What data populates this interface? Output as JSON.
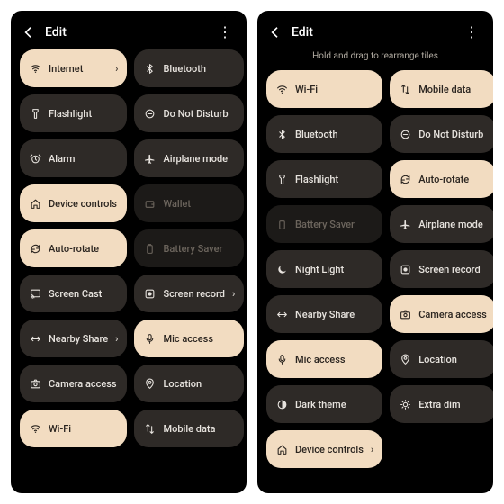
{
  "left": {
    "title": "Edit",
    "tiles": [
      {
        "icon": "wifi",
        "label": "Internet",
        "style": "light",
        "chevron": true
      },
      {
        "icon": "bluetooth",
        "label": "Bluetooth",
        "style": "dark"
      },
      {
        "icon": "flashlight",
        "label": "Flashlight",
        "style": "dark"
      },
      {
        "icon": "dnd",
        "label": "Do Not Disturb",
        "style": "dark"
      },
      {
        "icon": "alarm",
        "label": "Alarm",
        "style": "dark"
      },
      {
        "icon": "airplane",
        "label": "Airplane mode",
        "style": "dark"
      },
      {
        "icon": "home",
        "label": "Device controls",
        "style": "light"
      },
      {
        "icon": "wallet",
        "label": "Wallet",
        "style": "dim"
      },
      {
        "icon": "rotate",
        "label": "Auto-rotate",
        "style": "light"
      },
      {
        "icon": "battery",
        "label": "Battery Saver",
        "style": "dim"
      },
      {
        "icon": "cast",
        "label": "Screen Cast",
        "style": "dark"
      },
      {
        "icon": "record",
        "label": "Screen record",
        "style": "dark",
        "chevron": true
      },
      {
        "icon": "share",
        "label": "Nearby Share",
        "style": "dark",
        "chevron": true
      },
      {
        "icon": "mic",
        "label": "Mic access",
        "style": "light"
      },
      {
        "icon": "camera",
        "label": "Camera access",
        "style": "dark"
      },
      {
        "icon": "location",
        "label": "Location",
        "style": "dark"
      },
      {
        "icon": "wifi",
        "label": "Wi-Fi",
        "style": "light"
      },
      {
        "icon": "data",
        "label": "Mobile data",
        "style": "dark"
      }
    ]
  },
  "right": {
    "title": "Edit",
    "hint": "Hold and drag to rearrange tiles",
    "tiles": [
      {
        "icon": "wifi",
        "label": "Wi-Fi",
        "style": "light"
      },
      {
        "icon": "data",
        "label": "Mobile data",
        "style": "light"
      },
      {
        "icon": "bluetooth",
        "label": "Bluetooth",
        "style": "dark"
      },
      {
        "icon": "dnd",
        "label": "Do Not Disturb",
        "style": "dark"
      },
      {
        "icon": "flashlight",
        "label": "Flashlight",
        "style": "dark"
      },
      {
        "icon": "rotate",
        "label": "Auto-rotate",
        "style": "light"
      },
      {
        "icon": "battery",
        "label": "Battery Saver",
        "style": "dim"
      },
      {
        "icon": "airplane",
        "label": "Airplane mode",
        "style": "dark"
      },
      {
        "icon": "moon",
        "label": "Night Light",
        "style": "dark"
      },
      {
        "icon": "record",
        "label": "Screen record",
        "style": "dark"
      },
      {
        "icon": "share",
        "label": "Nearby Share",
        "style": "dark"
      },
      {
        "icon": "camera",
        "label": "Camera access",
        "style": "light"
      },
      {
        "icon": "mic",
        "label": "Mic access",
        "style": "light"
      },
      {
        "icon": "location",
        "label": "Location",
        "style": "dark"
      },
      {
        "icon": "darktheme",
        "label": "Dark theme",
        "style": "dark"
      },
      {
        "icon": "extradim",
        "label": "Extra dim",
        "style": "dark"
      },
      {
        "icon": "home",
        "label": "Device controls",
        "style": "light",
        "chevron": true
      }
    ]
  },
  "icons": {
    "wifi": "◈",
    "bluetooth": "ᚼ",
    "flashlight": "▮",
    "dnd": "⊖",
    "alarm": "⏰",
    "airplane": "✈",
    "home": "⌂",
    "wallet": "▭",
    "rotate": "⟳",
    "battery": "▯",
    "cast": "⎚",
    "record": "◉",
    "share": "⇄",
    "mic": "🎤",
    "camera": "▢",
    "location": "📍",
    "data": "↕",
    "moon": "☾",
    "darktheme": "◐",
    "extradim": "✦"
  }
}
